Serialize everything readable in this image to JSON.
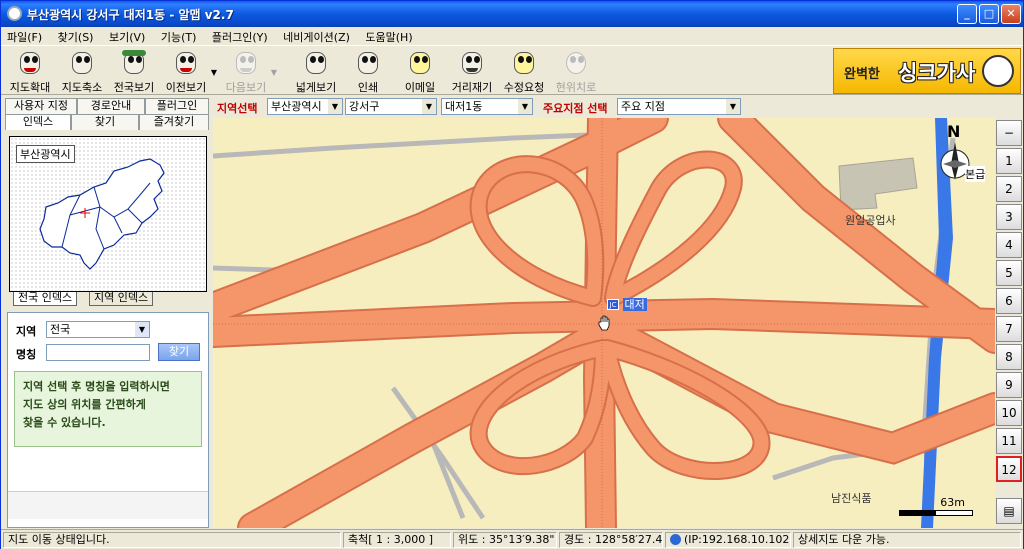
{
  "window": {
    "title": "부산광역시 강서구 대저1동 - 알맵 v2.7",
    "min": "_",
    "max": "□",
    "close": "✕"
  },
  "menu": [
    "파일(F)",
    "찾기(S)",
    "보기(V)",
    "기능(T)",
    "플러그인(Y)",
    "네비게이션(Z)",
    "도움말(H)"
  ],
  "toolbar": {
    "zoom_in": "지도확대",
    "zoom_out": "지도축소",
    "country_view": "전국보기",
    "prev_view": "이전보기",
    "next_view": "다음보기",
    "wide_view": "넓게보기",
    "print": "인쇄",
    "email": "이메일",
    "measure": "거리재기",
    "correction": "수정요청",
    "my_location": "현위치로",
    "banner_small": "완벽한",
    "banner_big": "싱크가사"
  },
  "left_tabs": {
    "row1": [
      "사용자 지정",
      "경로안내",
      "플러그인"
    ],
    "row2": [
      "인덱스",
      "찾기",
      "즐겨찾기"
    ]
  },
  "overview": {
    "label": "부산광역시"
  },
  "index_tabs": [
    "전국 인덱스",
    "지역 인덱스"
  ],
  "search": {
    "region_label": "지역",
    "region_value": "전국",
    "name_label": "명칭",
    "name_value": "",
    "find_button": "찾기",
    "help_lines": [
      "지역 선택 후 명칭을 입력하시면",
      "지도 상의 위치를 간편하게",
      "찾을 수 있습니다."
    ]
  },
  "region_bar": {
    "region_label": "지역선택",
    "city": "부산광역시",
    "district": "강서구",
    "dong": "대저1동",
    "poi_label": "주요지점 선택",
    "poi_value": "주요 지점"
  },
  "map": {
    "labels": {
      "factory": "원일공업사",
      "food": "남진식품",
      "office": "본급"
    },
    "poi_badge": "JC",
    "poi_name": "대저",
    "compass_letter": "N",
    "scale_text": "63m",
    "colors": {
      "land": "#f7eec0",
      "road": "#f4956a",
      "road_edge": "#d7704a",
      "river": "#3a78e8",
      "minor_road": "#b8b8b8"
    }
  },
  "zoom_levels": [
    "1",
    "2",
    "3",
    "4",
    "5",
    "6",
    "7",
    "8",
    "9",
    "10",
    "11",
    "12"
  ],
  "zoom_current": "12",
  "zoom_top": "−",
  "status": {
    "message": "지도 이동 상태입니다.",
    "scale": "축척[ 1 : 3,000 ]",
    "lat": "위도 : 35°13′9.38\"",
    "lon": "경도 : 128°58′27.48\"",
    "ip": "(IP:192.168.10.102)",
    "detail": "상세지도 다운 가능."
  }
}
